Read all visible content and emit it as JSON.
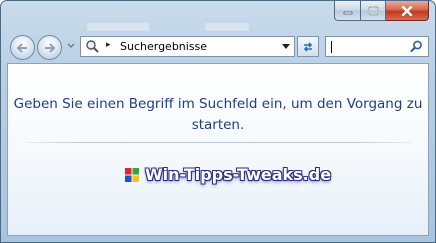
{
  "window": {
    "caption_buttons": {
      "minimize_icon": "minimize-icon",
      "maximize_icon": "maximize-icon",
      "close_icon": "close-icon"
    }
  },
  "navigation": {
    "back_icon": "back-arrow-icon",
    "forward_icon": "forward-arrow-icon",
    "recent_icon": "chevron-down-icon"
  },
  "address_bar": {
    "location_icon": "search-folder-icon",
    "breadcrumb_separator": "▸",
    "path": "Suchergebnisse"
  },
  "search": {
    "value": "",
    "icon": "search-icon"
  },
  "content": {
    "message": "Geben Sie einen Begriff im Suchfeld ein, um den Vorgang zu starten.",
    "watermark": {
      "logo_icon": "windows-flag-icon",
      "text": "Win-Tipps-Tweaks.de"
    }
  },
  "colors": {
    "accent": "#1e3f86",
    "frame": "#b9cfe3",
    "close": "#c0391d"
  }
}
